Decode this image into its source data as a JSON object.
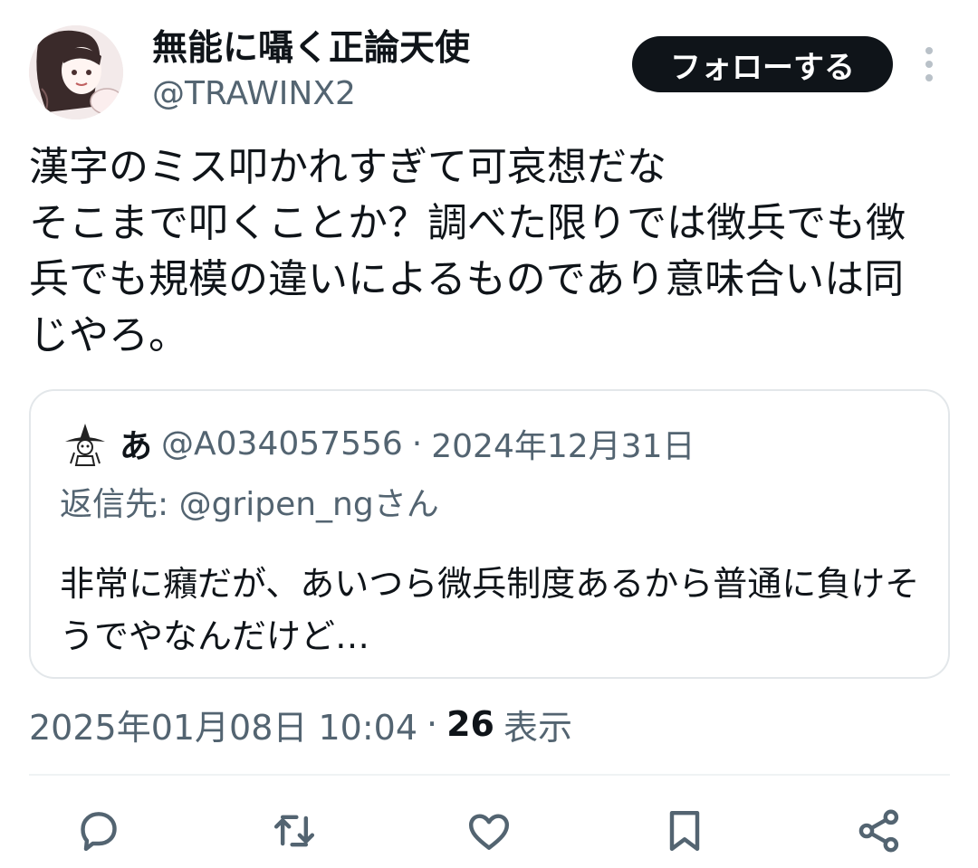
{
  "author": {
    "display_name": "無能に囁く正論天使",
    "handle": "@TRAWINX2",
    "follow_label": "フォローする"
  },
  "tweet": {
    "text": "漢字のミス叩かれすぎて可哀想だな\nそこまで叩くことか？調べた限りでは徴兵でも徴兵でも規模の違いによるものであり意味合いは同じやろ。"
  },
  "quote": {
    "name": "あ",
    "handle": "@A034057556",
    "separator": "·",
    "date": "2024年12月31日",
    "reply_prefix": "返信先: ",
    "reply_to": "@gripen_ngさん",
    "text": "非常に癪だが、あいつら微兵制度あるから普通に負けそうでやなんだけど…"
  },
  "meta": {
    "timestamp": "2025年01月08日 10:04",
    "separator": "·",
    "views_count": "26",
    "views_label": "表示"
  },
  "actions": [
    "reply-icon",
    "retweet-icon",
    "like-icon",
    "bookmark-icon",
    "share-icon"
  ],
  "colors": {
    "text_primary": "#0f1419",
    "text_secondary": "#536471",
    "border": "#e3e7ea",
    "follow_bg": "#0f1419"
  }
}
